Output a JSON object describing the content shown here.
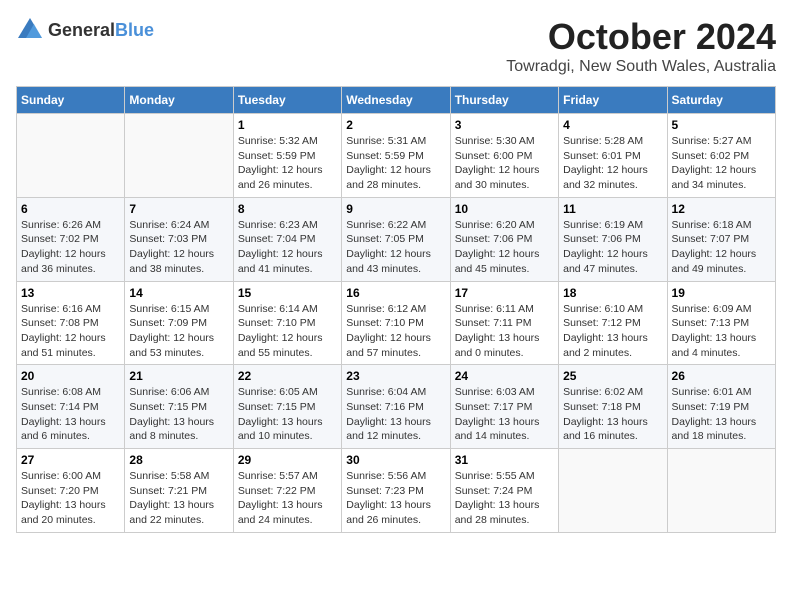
{
  "logo": {
    "text_general": "General",
    "text_blue": "Blue"
  },
  "header": {
    "month": "October 2024",
    "location": "Towradgi, New South Wales, Australia"
  },
  "days_of_week": [
    "Sunday",
    "Monday",
    "Tuesday",
    "Wednesday",
    "Thursday",
    "Friday",
    "Saturday"
  ],
  "weeks": [
    [
      {
        "day": "",
        "sunrise": "",
        "sunset": "",
        "daylight": ""
      },
      {
        "day": "",
        "sunrise": "",
        "sunset": "",
        "daylight": ""
      },
      {
        "day": "1",
        "sunrise": "Sunrise: 5:32 AM",
        "sunset": "Sunset: 5:59 PM",
        "daylight": "Daylight: 12 hours and 26 minutes."
      },
      {
        "day": "2",
        "sunrise": "Sunrise: 5:31 AM",
        "sunset": "Sunset: 5:59 PM",
        "daylight": "Daylight: 12 hours and 28 minutes."
      },
      {
        "day": "3",
        "sunrise": "Sunrise: 5:30 AM",
        "sunset": "Sunset: 6:00 PM",
        "daylight": "Daylight: 12 hours and 30 minutes."
      },
      {
        "day": "4",
        "sunrise": "Sunrise: 5:28 AM",
        "sunset": "Sunset: 6:01 PM",
        "daylight": "Daylight: 12 hours and 32 minutes."
      },
      {
        "day": "5",
        "sunrise": "Sunrise: 5:27 AM",
        "sunset": "Sunset: 6:02 PM",
        "daylight": "Daylight: 12 hours and 34 minutes."
      }
    ],
    [
      {
        "day": "6",
        "sunrise": "Sunrise: 6:26 AM",
        "sunset": "Sunset: 7:02 PM",
        "daylight": "Daylight: 12 hours and 36 minutes."
      },
      {
        "day": "7",
        "sunrise": "Sunrise: 6:24 AM",
        "sunset": "Sunset: 7:03 PM",
        "daylight": "Daylight: 12 hours and 38 minutes."
      },
      {
        "day": "8",
        "sunrise": "Sunrise: 6:23 AM",
        "sunset": "Sunset: 7:04 PM",
        "daylight": "Daylight: 12 hours and 41 minutes."
      },
      {
        "day": "9",
        "sunrise": "Sunrise: 6:22 AM",
        "sunset": "Sunset: 7:05 PM",
        "daylight": "Daylight: 12 hours and 43 minutes."
      },
      {
        "day": "10",
        "sunrise": "Sunrise: 6:20 AM",
        "sunset": "Sunset: 7:06 PM",
        "daylight": "Daylight: 12 hours and 45 minutes."
      },
      {
        "day": "11",
        "sunrise": "Sunrise: 6:19 AM",
        "sunset": "Sunset: 7:06 PM",
        "daylight": "Daylight: 12 hours and 47 minutes."
      },
      {
        "day": "12",
        "sunrise": "Sunrise: 6:18 AM",
        "sunset": "Sunset: 7:07 PM",
        "daylight": "Daylight: 12 hours and 49 minutes."
      }
    ],
    [
      {
        "day": "13",
        "sunrise": "Sunrise: 6:16 AM",
        "sunset": "Sunset: 7:08 PM",
        "daylight": "Daylight: 12 hours and 51 minutes."
      },
      {
        "day": "14",
        "sunrise": "Sunrise: 6:15 AM",
        "sunset": "Sunset: 7:09 PM",
        "daylight": "Daylight: 12 hours and 53 minutes."
      },
      {
        "day": "15",
        "sunrise": "Sunrise: 6:14 AM",
        "sunset": "Sunset: 7:10 PM",
        "daylight": "Daylight: 12 hours and 55 minutes."
      },
      {
        "day": "16",
        "sunrise": "Sunrise: 6:12 AM",
        "sunset": "Sunset: 7:10 PM",
        "daylight": "Daylight: 12 hours and 57 minutes."
      },
      {
        "day": "17",
        "sunrise": "Sunrise: 6:11 AM",
        "sunset": "Sunset: 7:11 PM",
        "daylight": "Daylight: 13 hours and 0 minutes."
      },
      {
        "day": "18",
        "sunrise": "Sunrise: 6:10 AM",
        "sunset": "Sunset: 7:12 PM",
        "daylight": "Daylight: 13 hours and 2 minutes."
      },
      {
        "day": "19",
        "sunrise": "Sunrise: 6:09 AM",
        "sunset": "Sunset: 7:13 PM",
        "daylight": "Daylight: 13 hours and 4 minutes."
      }
    ],
    [
      {
        "day": "20",
        "sunrise": "Sunrise: 6:08 AM",
        "sunset": "Sunset: 7:14 PM",
        "daylight": "Daylight: 13 hours and 6 minutes."
      },
      {
        "day": "21",
        "sunrise": "Sunrise: 6:06 AM",
        "sunset": "Sunset: 7:15 PM",
        "daylight": "Daylight: 13 hours and 8 minutes."
      },
      {
        "day": "22",
        "sunrise": "Sunrise: 6:05 AM",
        "sunset": "Sunset: 7:15 PM",
        "daylight": "Daylight: 13 hours and 10 minutes."
      },
      {
        "day": "23",
        "sunrise": "Sunrise: 6:04 AM",
        "sunset": "Sunset: 7:16 PM",
        "daylight": "Daylight: 13 hours and 12 minutes."
      },
      {
        "day": "24",
        "sunrise": "Sunrise: 6:03 AM",
        "sunset": "Sunset: 7:17 PM",
        "daylight": "Daylight: 13 hours and 14 minutes."
      },
      {
        "day": "25",
        "sunrise": "Sunrise: 6:02 AM",
        "sunset": "Sunset: 7:18 PM",
        "daylight": "Daylight: 13 hours and 16 minutes."
      },
      {
        "day": "26",
        "sunrise": "Sunrise: 6:01 AM",
        "sunset": "Sunset: 7:19 PM",
        "daylight": "Daylight: 13 hours and 18 minutes."
      }
    ],
    [
      {
        "day": "27",
        "sunrise": "Sunrise: 6:00 AM",
        "sunset": "Sunset: 7:20 PM",
        "daylight": "Daylight: 13 hours and 20 minutes."
      },
      {
        "day": "28",
        "sunrise": "Sunrise: 5:58 AM",
        "sunset": "Sunset: 7:21 PM",
        "daylight": "Daylight: 13 hours and 22 minutes."
      },
      {
        "day": "29",
        "sunrise": "Sunrise: 5:57 AM",
        "sunset": "Sunset: 7:22 PM",
        "daylight": "Daylight: 13 hours and 24 minutes."
      },
      {
        "day": "30",
        "sunrise": "Sunrise: 5:56 AM",
        "sunset": "Sunset: 7:23 PM",
        "daylight": "Daylight: 13 hours and 26 minutes."
      },
      {
        "day": "31",
        "sunrise": "Sunrise: 5:55 AM",
        "sunset": "Sunset: 7:24 PM",
        "daylight": "Daylight: 13 hours and 28 minutes."
      },
      {
        "day": "",
        "sunrise": "",
        "sunset": "",
        "daylight": ""
      },
      {
        "day": "",
        "sunrise": "",
        "sunset": "",
        "daylight": ""
      }
    ]
  ]
}
